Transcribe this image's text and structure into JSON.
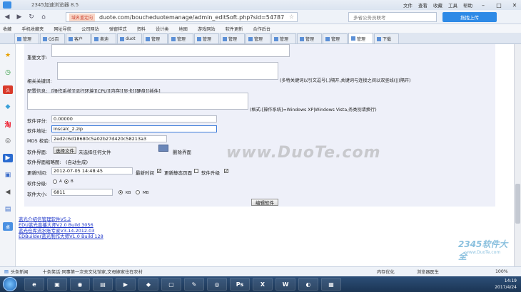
{
  "browser": {
    "title": "2345加速浏览器 8.5",
    "menu": [
      "文件",
      "查看",
      "收藏",
      "工具",
      "帮助"
    ],
    "url_badge": "域名重定向",
    "url": "duote.com/boucheduotemanage/admin_editSoft.php?sid=54787",
    "search_placeholder": "多省公务员联考",
    "cloud_button": "拖拽上传"
  },
  "bookmarks": [
    "收藏",
    "手机收藏夹",
    "网址导航",
    "公司网站",
    "弹窗样式",
    "资料",
    "设计类",
    "地图",
    "游戏网站",
    "软件更新",
    "合作后台"
  ],
  "tabs": [
    {
      "label": "管理"
    },
    {
      "label": "QS百"
    },
    {
      "label": "客户"
    },
    {
      "label": "奥迪"
    },
    {
      "label": "duot"
    },
    {
      "label": "管理"
    },
    {
      "label": "管理"
    },
    {
      "label": "管理"
    },
    {
      "label": "管理"
    },
    {
      "label": "管理"
    },
    {
      "label": "管理"
    },
    {
      "label": "管理"
    },
    {
      "label": "管理"
    },
    {
      "label": "管理",
      "active": true
    },
    {
      "label": "下载"
    }
  ],
  "form": {
    "important_text_label": "重要文字:",
    "keywords_label": "相关关键词:",
    "keywords_note": "(多特关键词以引文逗号(,)隔开,关键词与连接之间以双竖线(||)隔开)",
    "config_label": "配置信息:",
    "config_tags": "[操作系统][运行环境][CPU][内存][显卡][硬盘][插件]",
    "config_note": "(格式:[操作系统]=Windows XP|Windows Vista,务类别请换行)",
    "score_label": "软件评分:",
    "score_value": "0.00000",
    "address_label": "软件地址:",
    "address_value": "inscalc_2.zip",
    "md5_label": "MD5 校验:",
    "md5_value": "2ed2c6d18680c5a02b27d420c58213a3",
    "interface_label": "软件界面:",
    "choose_file_button": "选择文件",
    "no_file_text": "未选择任何文件",
    "delete_interface": "删除界面",
    "thumbnail_label": "软件界面缩略图:",
    "thumbnail_value": "(自动生成)",
    "update_time_label": "更新时间:",
    "update_time_value": "2012-07-05 14:48:45",
    "latest_time": "最新时间",
    "update_static": "更新静态页面",
    "software_upgrade": "软件升级",
    "grade_label": "软件分级:",
    "grade_a": "A",
    "grade_b": "B",
    "size_label": "软件大小:",
    "size_value": "6811",
    "unit_kb": "KB",
    "unit_mb": "MB",
    "edit_button": "编辑软件"
  },
  "links": [
    "蓝光介绍信管理软件V5.2",
    "EDU蓝光直播大师V2.0 Build 3056",
    "蓝光仓库流水账专家V3.14.2012.03",
    "EDBuilder蓝光制作大师V1.0 Build 128"
  ],
  "watermark": "www.DuoTe.com",
  "watermark2": "2345软件大全",
  "watermark2_url": "www.DuoTe.com",
  "status": {
    "news": "头条新闻",
    "ticker": "十条笑话:同事第一次去文化馆家,文母嫁家住在农村",
    "protection": "内存优化",
    "accelerate": "浏览器医生",
    "zoom": "100%"
  },
  "taskbar": {
    "time": "14:19",
    "date": "2017/4/24"
  }
}
